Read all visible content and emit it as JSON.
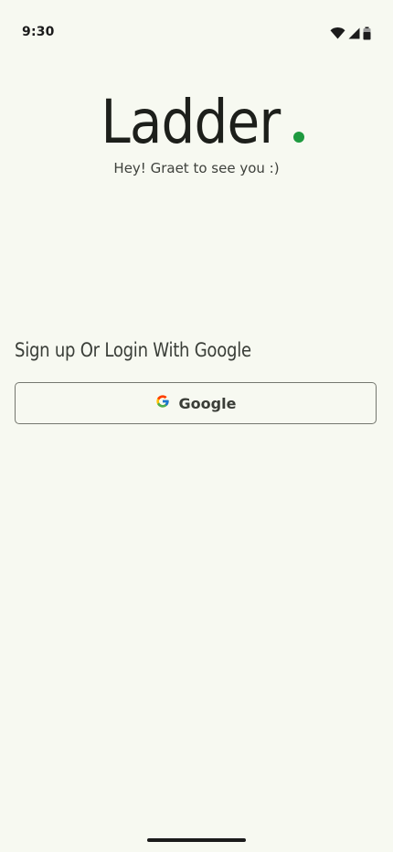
{
  "status_bar": {
    "time": "9:30",
    "icons": [
      "wifi-icon",
      "cellular-signal-icon",
      "battery-icon"
    ]
  },
  "brand": {
    "title": "Ladder",
    "accent_color": "#1e9a3f",
    "subtitle": "Hey! Graet to see you :)"
  },
  "login": {
    "heading": "Sign up Or Login With Google",
    "google_button_label": "Google",
    "google_icon": "google-g-icon"
  },
  "colors": {
    "background": "#f7f9f1",
    "text": "#1d201c",
    "button_border": "#74776f"
  }
}
